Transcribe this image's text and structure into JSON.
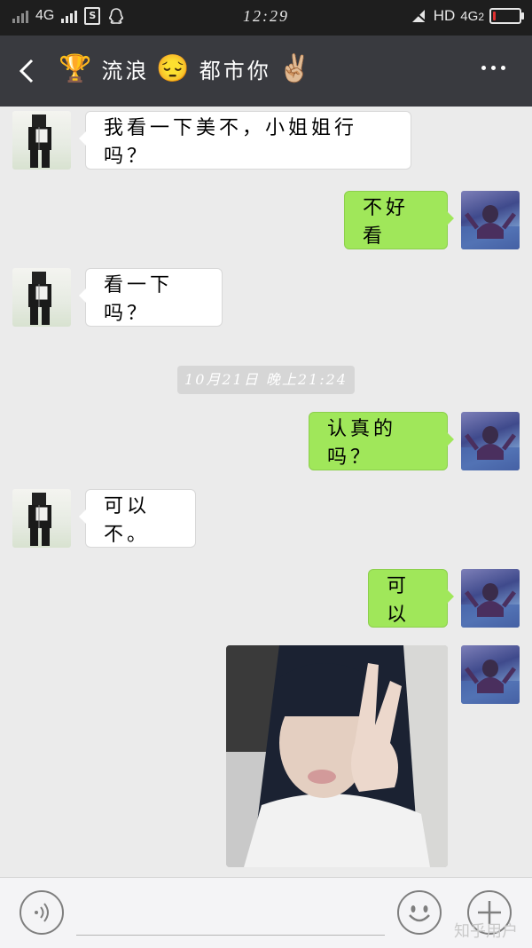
{
  "status_bar": {
    "network_type": "4G",
    "sim_badge": "S",
    "time": "12:29",
    "hd_label": "HD",
    "network_right": "4G",
    "network_right_sub": "2",
    "battery_level": 0.12,
    "battery_color": "#e03030",
    "icons": [
      "signal-icon",
      "qq-icon",
      "mute-icon",
      "battery-icon"
    ]
  },
  "header": {
    "back_icon": "chevron-left-icon",
    "trophy_emoji": "🏆",
    "name_part1": "流浪",
    "pensive_emoji": "😔",
    "name_part2": "都市你",
    "victory_emoji": "✌🏼",
    "more_icon": "more-icon"
  },
  "messages": [
    {
      "side": "in",
      "text": "我看一下美不，小姐姐行吗？"
    },
    {
      "side": "out",
      "text": "不好看"
    },
    {
      "side": "in",
      "text": "看一下吗？"
    },
    {
      "side": "out",
      "text": "认真的吗？"
    },
    {
      "side": "in",
      "text": "可以不。"
    },
    {
      "side": "out",
      "text": "可以"
    }
  ],
  "timestamp": "10月21日 晚上21:24",
  "photo_message": {
    "side": "out",
    "kind": "photo",
    "subject": "selfie"
  },
  "input_bar": {
    "voice_icon": "voice-icon",
    "emoji_icon": "emoji-icon",
    "plus_icon": "plus-icon"
  },
  "watermark": "知乎用户",
  "colors": {
    "header_bg": "#393a3f",
    "chat_bg": "#ebebeb",
    "outgoing_bubble": "#a0e75a",
    "incoming_bubble": "#ffffff"
  }
}
